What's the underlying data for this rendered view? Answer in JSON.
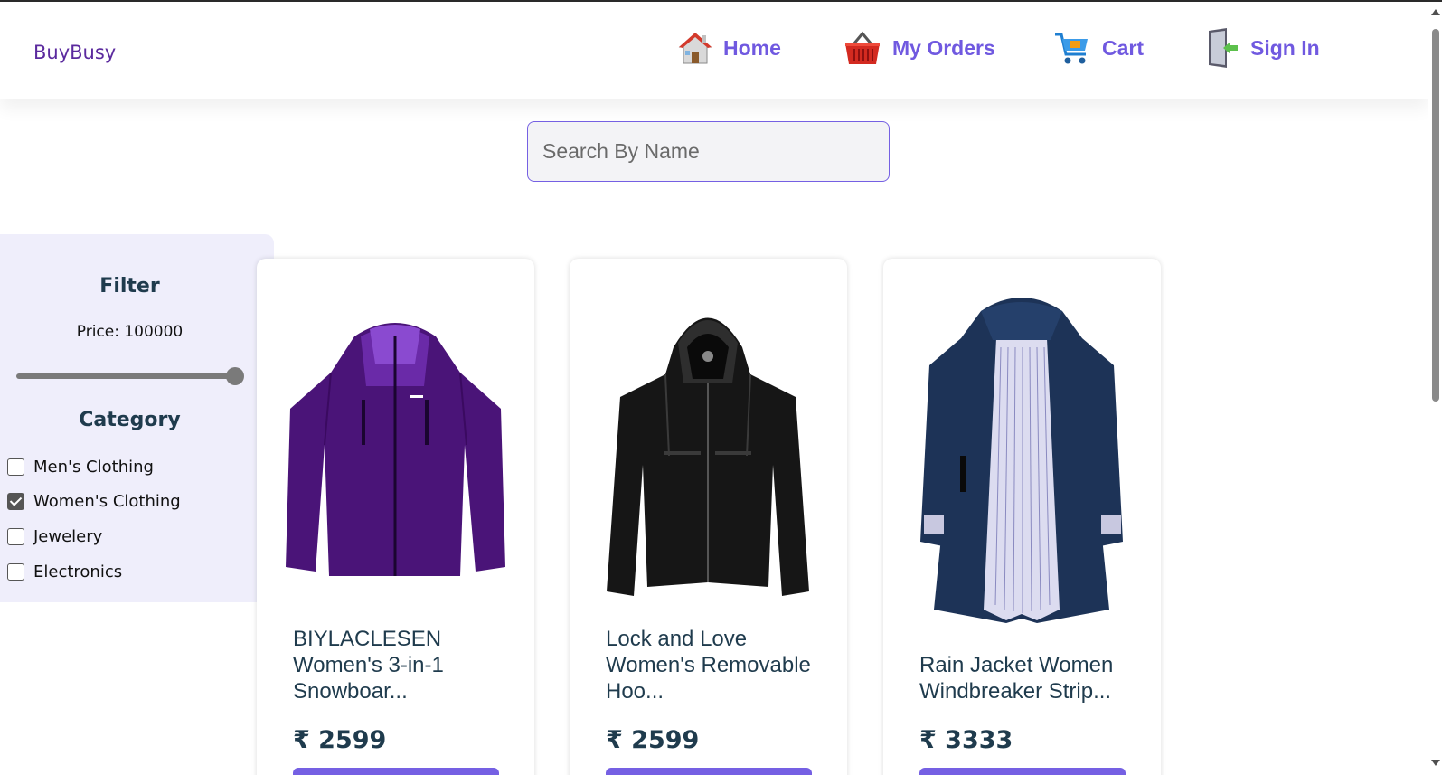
{
  "brand": "BuyBusy",
  "nav": {
    "home": "Home",
    "orders": "My Orders",
    "cart": "Cart",
    "signin": "Sign In"
  },
  "search": {
    "placeholder": "Search By Name",
    "value": ""
  },
  "filter": {
    "title": "Filter",
    "price_label": "Price: 100000",
    "price_value": 100000,
    "price_fraction": 1.0,
    "category_title": "Category",
    "categories": [
      {
        "label": "Men's Clothing",
        "checked": false
      },
      {
        "label": "Women's Clothing",
        "checked": true
      },
      {
        "label": "Jewelery",
        "checked": false
      },
      {
        "label": "Electronics",
        "checked": false
      }
    ]
  },
  "products": [
    {
      "name": "BIYLACLESEN Women's 3-in-1 Snowboar...",
      "price": "₹ 2599",
      "image": "purple-jacket"
    },
    {
      "name": "Lock and Love Women's Removable Hoo...",
      "price": "₹ 2599",
      "image": "black-leather-jacket"
    },
    {
      "name": "Rain Jacket Women Windbreaker Strip...",
      "price": "₹ 3333",
      "image": "navy-rain-jacket"
    }
  ],
  "colors": {
    "accent": "#7560e3",
    "brand": "#5b2a9e",
    "text_dark": "#1f3b4d",
    "filter_bg": "#efeefb"
  }
}
